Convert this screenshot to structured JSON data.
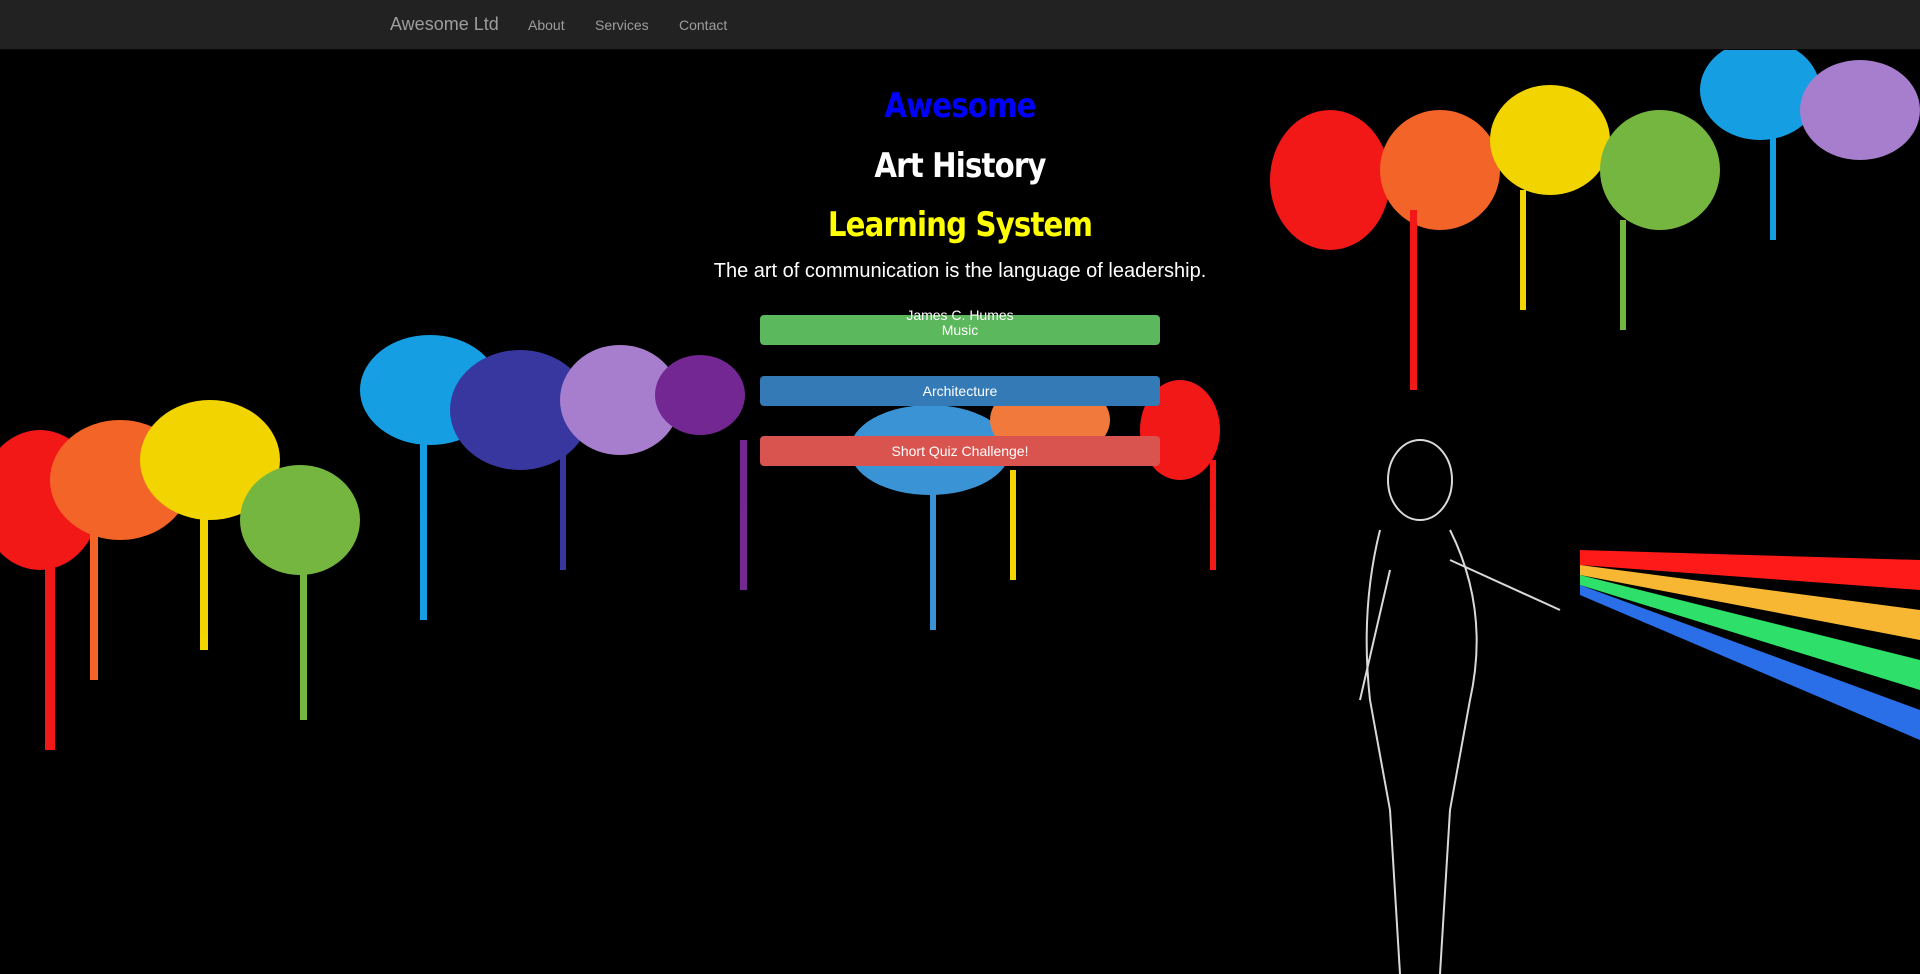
{
  "navbar": {
    "brand": "Awesome Ltd",
    "links": [
      "About",
      "Services",
      "Contact"
    ]
  },
  "hero": {
    "title_line1": "Awesome",
    "title_line2": "Art History",
    "title_line3": "Learning System",
    "quote": "The art of communication is the language of leadership.",
    "author": "James C. Humes"
  },
  "buttons": {
    "music": "Music",
    "architecture": "Architecture",
    "quiz": "Short Quiz Challenge!"
  },
  "colors": {
    "navbar_bg": "#222222",
    "title_line1": "#0000ff",
    "title_line2": "#ffffff",
    "title_line3": "#ffff00",
    "music_button": "#5cb85c",
    "architecture_button": "#337ab7",
    "quiz_button": "#d9534f"
  },
  "background": {
    "image": "paint-splatter-graffiti-artist"
  }
}
